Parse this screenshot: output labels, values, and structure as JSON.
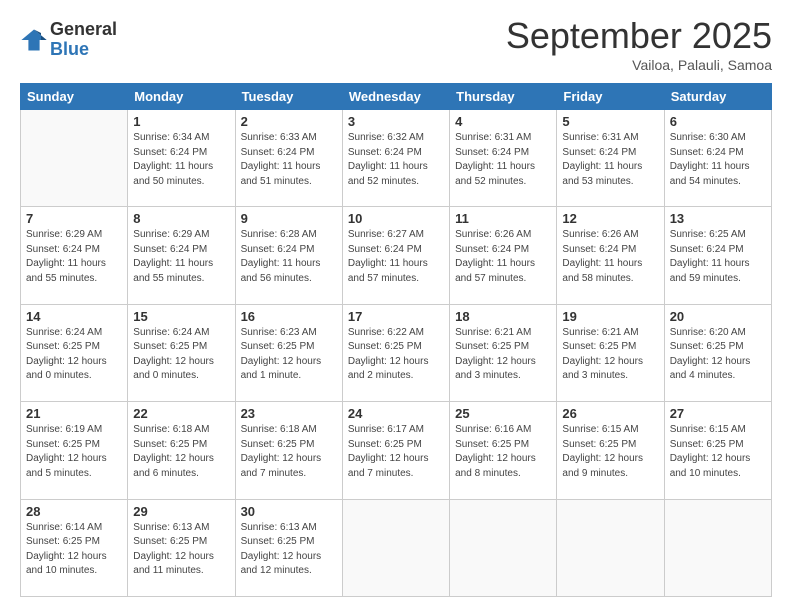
{
  "header": {
    "logo_line1": "General",
    "logo_line2": "Blue",
    "month": "September 2025",
    "location": "Vailoa, Palauli, Samoa"
  },
  "days_of_week": [
    "Sunday",
    "Monday",
    "Tuesday",
    "Wednesday",
    "Thursday",
    "Friday",
    "Saturday"
  ],
  "weeks": [
    [
      {
        "day": "",
        "info": ""
      },
      {
        "day": "1",
        "info": "Sunrise: 6:34 AM\nSunset: 6:24 PM\nDaylight: 11 hours\nand 50 minutes."
      },
      {
        "day": "2",
        "info": "Sunrise: 6:33 AM\nSunset: 6:24 PM\nDaylight: 11 hours\nand 51 minutes."
      },
      {
        "day": "3",
        "info": "Sunrise: 6:32 AM\nSunset: 6:24 PM\nDaylight: 11 hours\nand 52 minutes."
      },
      {
        "day": "4",
        "info": "Sunrise: 6:31 AM\nSunset: 6:24 PM\nDaylight: 11 hours\nand 52 minutes."
      },
      {
        "day": "5",
        "info": "Sunrise: 6:31 AM\nSunset: 6:24 PM\nDaylight: 11 hours\nand 53 minutes."
      },
      {
        "day": "6",
        "info": "Sunrise: 6:30 AM\nSunset: 6:24 PM\nDaylight: 11 hours\nand 54 minutes."
      }
    ],
    [
      {
        "day": "7",
        "info": "Sunrise: 6:29 AM\nSunset: 6:24 PM\nDaylight: 11 hours\nand 55 minutes."
      },
      {
        "day": "8",
        "info": "Sunrise: 6:29 AM\nSunset: 6:24 PM\nDaylight: 11 hours\nand 55 minutes."
      },
      {
        "day": "9",
        "info": "Sunrise: 6:28 AM\nSunset: 6:24 PM\nDaylight: 11 hours\nand 56 minutes."
      },
      {
        "day": "10",
        "info": "Sunrise: 6:27 AM\nSunset: 6:24 PM\nDaylight: 11 hours\nand 57 minutes."
      },
      {
        "day": "11",
        "info": "Sunrise: 6:26 AM\nSunset: 6:24 PM\nDaylight: 11 hours\nand 57 minutes."
      },
      {
        "day": "12",
        "info": "Sunrise: 6:26 AM\nSunset: 6:24 PM\nDaylight: 11 hours\nand 58 minutes."
      },
      {
        "day": "13",
        "info": "Sunrise: 6:25 AM\nSunset: 6:24 PM\nDaylight: 11 hours\nand 59 minutes."
      }
    ],
    [
      {
        "day": "14",
        "info": "Sunrise: 6:24 AM\nSunset: 6:25 PM\nDaylight: 12 hours\nand 0 minutes."
      },
      {
        "day": "15",
        "info": "Sunrise: 6:24 AM\nSunset: 6:25 PM\nDaylight: 12 hours\nand 0 minutes."
      },
      {
        "day": "16",
        "info": "Sunrise: 6:23 AM\nSunset: 6:25 PM\nDaylight: 12 hours\nand 1 minute."
      },
      {
        "day": "17",
        "info": "Sunrise: 6:22 AM\nSunset: 6:25 PM\nDaylight: 12 hours\nand 2 minutes."
      },
      {
        "day": "18",
        "info": "Sunrise: 6:21 AM\nSunset: 6:25 PM\nDaylight: 12 hours\nand 3 minutes."
      },
      {
        "day": "19",
        "info": "Sunrise: 6:21 AM\nSunset: 6:25 PM\nDaylight: 12 hours\nand 3 minutes."
      },
      {
        "day": "20",
        "info": "Sunrise: 6:20 AM\nSunset: 6:25 PM\nDaylight: 12 hours\nand 4 minutes."
      }
    ],
    [
      {
        "day": "21",
        "info": "Sunrise: 6:19 AM\nSunset: 6:25 PM\nDaylight: 12 hours\nand 5 minutes."
      },
      {
        "day": "22",
        "info": "Sunrise: 6:18 AM\nSunset: 6:25 PM\nDaylight: 12 hours\nand 6 minutes."
      },
      {
        "day": "23",
        "info": "Sunrise: 6:18 AM\nSunset: 6:25 PM\nDaylight: 12 hours\nand 7 minutes."
      },
      {
        "day": "24",
        "info": "Sunrise: 6:17 AM\nSunset: 6:25 PM\nDaylight: 12 hours\nand 7 minutes."
      },
      {
        "day": "25",
        "info": "Sunrise: 6:16 AM\nSunset: 6:25 PM\nDaylight: 12 hours\nand 8 minutes."
      },
      {
        "day": "26",
        "info": "Sunrise: 6:15 AM\nSunset: 6:25 PM\nDaylight: 12 hours\nand 9 minutes."
      },
      {
        "day": "27",
        "info": "Sunrise: 6:15 AM\nSunset: 6:25 PM\nDaylight: 12 hours\nand 10 minutes."
      }
    ],
    [
      {
        "day": "28",
        "info": "Sunrise: 6:14 AM\nSunset: 6:25 PM\nDaylight: 12 hours\nand 10 minutes."
      },
      {
        "day": "29",
        "info": "Sunrise: 6:13 AM\nSunset: 6:25 PM\nDaylight: 12 hours\nand 11 minutes."
      },
      {
        "day": "30",
        "info": "Sunrise: 6:13 AM\nSunset: 6:25 PM\nDaylight: 12 hours\nand 12 minutes."
      },
      {
        "day": "",
        "info": ""
      },
      {
        "day": "",
        "info": ""
      },
      {
        "day": "",
        "info": ""
      },
      {
        "day": "",
        "info": ""
      }
    ]
  ]
}
